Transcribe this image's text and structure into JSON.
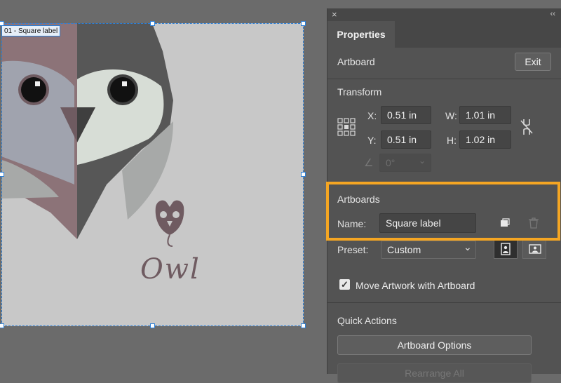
{
  "artboard": {
    "label": "01 - Square label",
    "logo_text": "Owl"
  },
  "panel": {
    "tab_label": "Properties",
    "close_icon": "×",
    "collapse_icon": "‹‹",
    "artboard_section": {
      "title": "Artboard",
      "exit_label": "Exit"
    },
    "transform": {
      "title": "Transform",
      "x_label": "X:",
      "x_value": "0.51 in",
      "y_label": "Y:",
      "y_value": "0.51 in",
      "w_label": "W:",
      "w_value": "1.01 in",
      "h_label": "H:",
      "h_value": "1.02 in",
      "rotate_value": "0°"
    },
    "artboards": {
      "title": "Artboards",
      "name_label": "Name:",
      "name_value": "Square label",
      "preset_label": "Preset:",
      "preset_value": "Custom"
    },
    "move_artwork": {
      "label": "Move Artwork with Artboard",
      "checked": true
    },
    "quick_actions": {
      "title": "Quick Actions",
      "artboard_options_label": "Artboard Options",
      "rearrange_label": "Rearrange All"
    }
  },
  "colors": {
    "highlight": "#f5a623",
    "selection": "#2d7fd6",
    "panel_bg": "#535353"
  }
}
